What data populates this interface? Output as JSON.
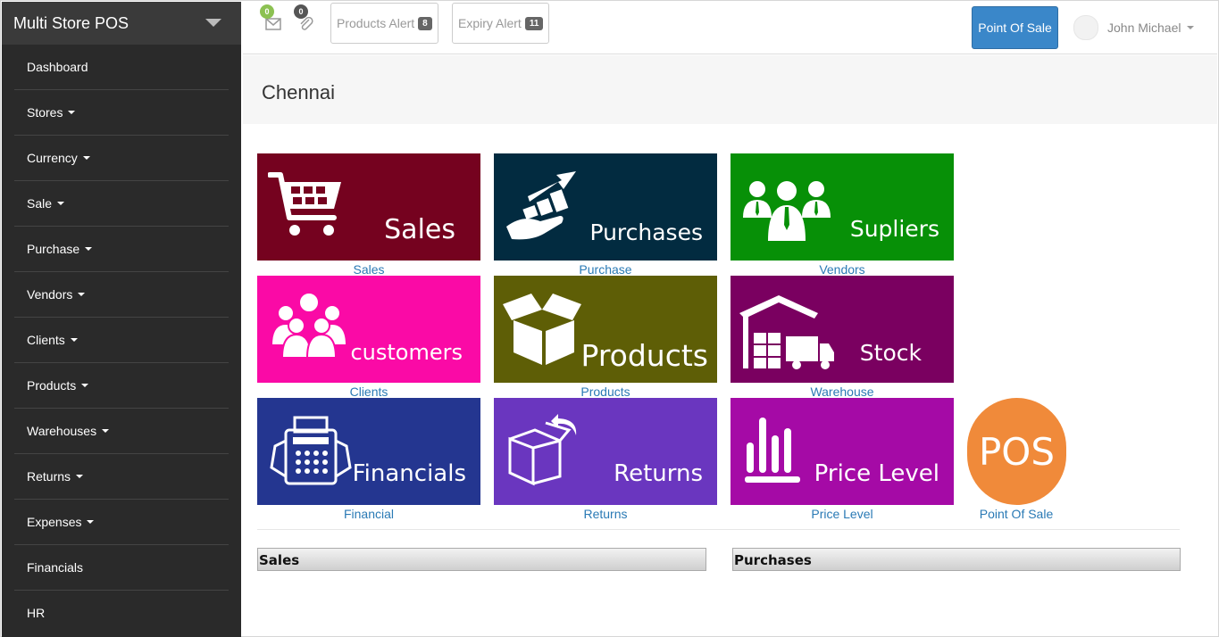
{
  "brand": {
    "title": "Multi Store POS"
  },
  "sidebar": {
    "items": [
      {
        "label": "Dashboard",
        "dropdown": false
      },
      {
        "label": "Stores",
        "dropdown": true
      },
      {
        "label": "Currency",
        "dropdown": true
      },
      {
        "label": "Sale",
        "dropdown": true
      },
      {
        "label": "Purchase",
        "dropdown": true
      },
      {
        "label": "Vendors",
        "dropdown": true
      },
      {
        "label": "Clients",
        "dropdown": true
      },
      {
        "label": "Products",
        "dropdown": true
      },
      {
        "label": "Warehouses",
        "dropdown": true
      },
      {
        "label": "Returns",
        "dropdown": true
      },
      {
        "label": "Expenses",
        "dropdown": true
      },
      {
        "label": "Financials",
        "dropdown": false
      },
      {
        "label": "HR",
        "dropdown": false
      }
    ]
  },
  "topbar": {
    "messages": {
      "icon": "envelope-icon",
      "count": "0",
      "badge_color": "#8cc152"
    },
    "attachments": {
      "icon": "paperclip-icon",
      "count": "0",
      "badge_color": "#555555"
    },
    "products_alert": {
      "label": "Products Alert",
      "count": "8"
    },
    "expiry_alert": {
      "label": "Expiry Alert",
      "count": "11"
    },
    "pos_button": "Point Of Sale",
    "user_name": "John Michael"
  },
  "page": {
    "title": "Chennai"
  },
  "tiles": [
    {
      "text": "Sales",
      "label": "Sales",
      "color": "#75021f",
      "icon": "shopping-cart-icon"
    },
    {
      "text": "Purchases",
      "label": "Purchase",
      "color": "#022b40",
      "icon": "growth-hand-icon"
    },
    {
      "text": "Supliers",
      "label": "Vendors",
      "color": "#079007",
      "icon": "people-group-icon"
    },
    {
      "text": "customers",
      "label": "Clients",
      "color": "#fa0aa6",
      "icon": "customers-icon"
    },
    {
      "text": "Products",
      "label": "Products",
      "color": "#5e5e06",
      "icon": "open-box-icon"
    },
    {
      "text": "Stock",
      "label": "Warehouse",
      "color": "#7a0060",
      "icon": "warehouse-truck-icon"
    },
    {
      "text": "Financials",
      "label": "Financial",
      "color": "#243690",
      "icon": "cash-register-icon"
    },
    {
      "text": "Returns",
      "label": "Returns",
      "color": "#6a36bf",
      "icon": "return-box-icon"
    },
    {
      "text": "Price Level",
      "label": "Price Level",
      "color": "#a50aa6",
      "icon": "bar-chart-icon"
    }
  ],
  "pos_tile": {
    "text": "POS",
    "label": "Point Of Sale",
    "color": "#f08a3a"
  },
  "panels": {
    "sales": "Sales",
    "purchases": "Purchases"
  }
}
